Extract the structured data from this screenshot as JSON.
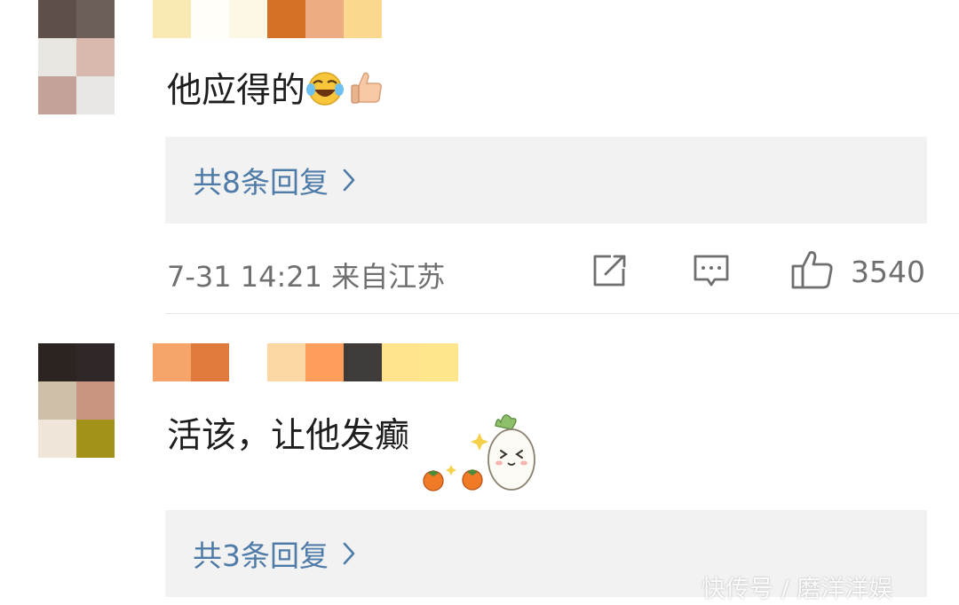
{
  "comments": [
    {
      "avatar_colors": [
        "#5e5048",
        "#6b5f58",
        "#ffffff",
        "#e8e6e0",
        "#d9b8ae",
        "#ffffff",
        "#c4a29a",
        "#e8e6e3",
        "#ffffff"
      ],
      "name_colors": [
        "#fbe9b4",
        "#fffef8",
        "#fdf8e6",
        "#d57127",
        "#eeac84",
        "#fbd790"
      ],
      "text": "他应得的",
      "emojis": [
        "laughing-crying-emoji",
        "thumbs-up-emoji"
      ],
      "reply_label": "共8条回复",
      "meta": "7-31 14:21 来自江苏",
      "like_count": "3540"
    },
    {
      "avatar_colors": [
        "#2c2420",
        "#302828",
        "#ffffff",
        "#cdbfa8",
        "#c99480",
        "#ffffff",
        "#efe5d8",
        "#a2921a",
        "#ffffff"
      ],
      "name_colors": [
        "#f6a46a",
        "#df7a3c",
        "#ffffff",
        "#fbd7a4",
        "#fd9e5a",
        "#3f3b39",
        "#fee28c",
        "#fde68c"
      ],
      "text": "活该，让他发癫",
      "sticker": "radish-persimmon-sticker",
      "reply_label": "共3条回复"
    }
  ],
  "watermark": "快传号 / 磨洋洋娱",
  "colors": {
    "link": "#4f7ba8",
    "meta": "#6f6f6f",
    "reply_bg": "#f2f2f2"
  },
  "icons": [
    "share-icon",
    "comment-icon",
    "like-icon",
    "chevron-right-icon"
  ]
}
